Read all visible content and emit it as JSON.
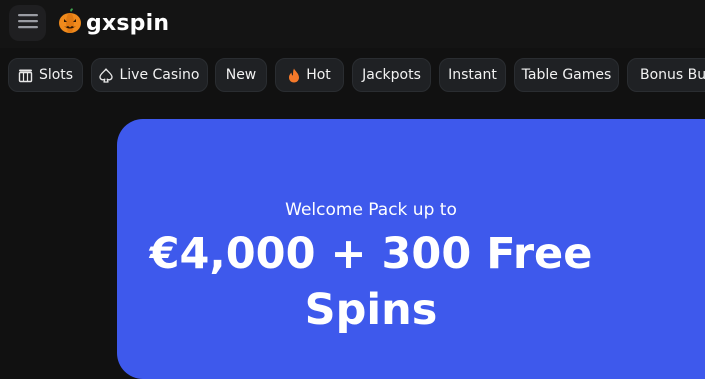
{
  "header": {
    "brand": "gxspin",
    "menu_icon": "hamburger-icon",
    "logo_icon": "pumpkin-icon"
  },
  "categories": [
    {
      "label": "Slots",
      "icon": "slot-machine-icon"
    },
    {
      "label": "Live Casino",
      "icon": "spade-icon"
    },
    {
      "label": "New",
      "icon": ""
    },
    {
      "label": "Hot",
      "icon": "flame-icon"
    },
    {
      "label": "Jackpots",
      "icon": ""
    },
    {
      "label": "Instant",
      "icon": ""
    },
    {
      "label": "Table Games",
      "icon": ""
    },
    {
      "label": "Bonus Buy",
      "icon": ""
    }
  ],
  "hero": {
    "subtitle": "Welcome Pack up to",
    "title_line1": "€4,000 + 300 Free",
    "title_line2": "Spins"
  },
  "colors": {
    "background": "#111111",
    "chip": "#1f2124",
    "hero": "#3e59ec",
    "flame": "#f5792a",
    "pumpkin": "#f08a1c"
  }
}
